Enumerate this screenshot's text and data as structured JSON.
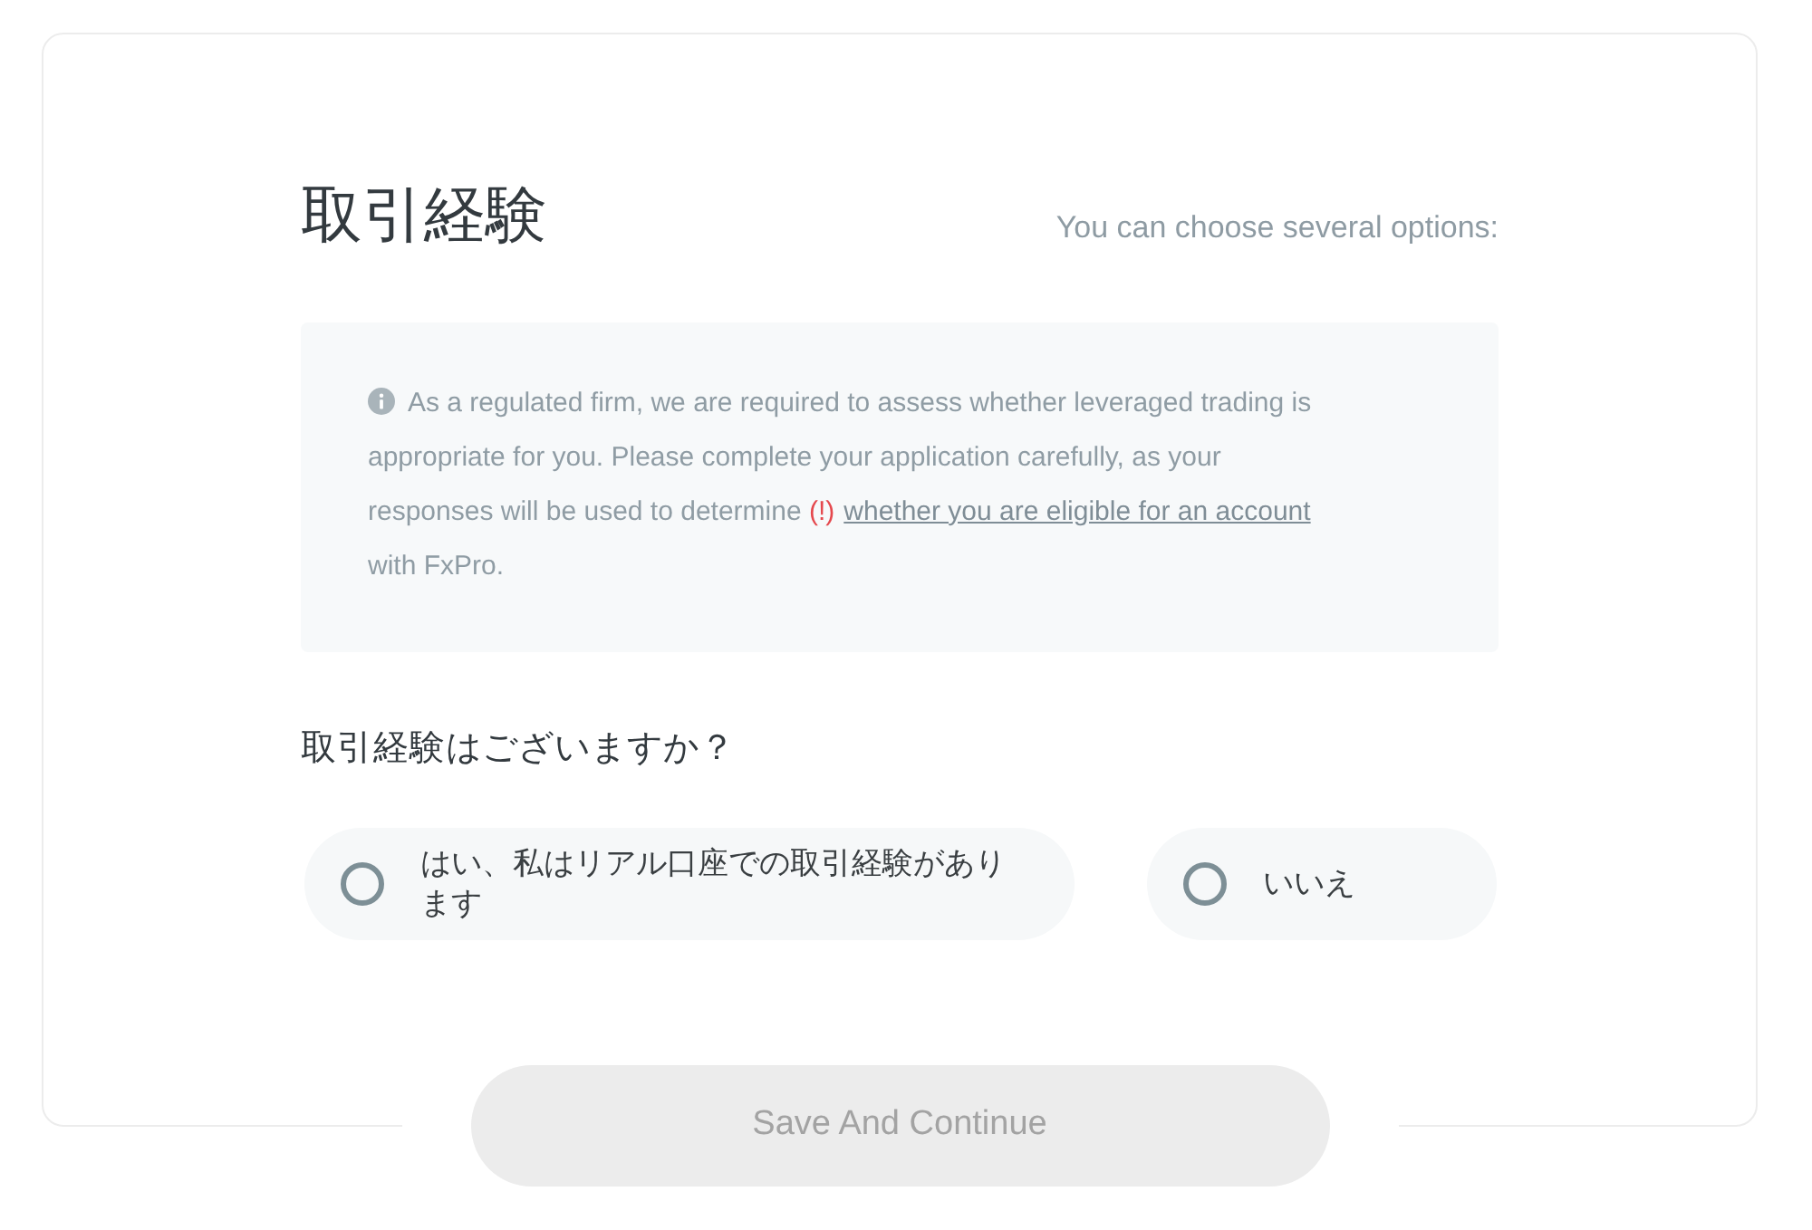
{
  "title": "取引経験",
  "hint": "You can choose several options:",
  "notice": {
    "parts": [
      {
        "kind": "text",
        "text": "As a regulated firm, we are required to assess whether leveraged trading is appropriate for you. Please complete your application carefully, as your responses will be used to determine "
      },
      {
        "kind": "warning",
        "text": "(!)"
      },
      {
        "kind": "link",
        "text": "whether you are eligible for an account"
      },
      {
        "kind": "text",
        "text": " with FxPro."
      }
    ]
  },
  "question": "取引経験はございますか？",
  "options": [
    {
      "label": "はい、私はリアル口座での取引経験があります",
      "selected": false
    },
    {
      "label": "いいえ",
      "selected": false
    }
  ],
  "submit_button": {
    "label": "Save And Continue",
    "disabled": true
  }
}
